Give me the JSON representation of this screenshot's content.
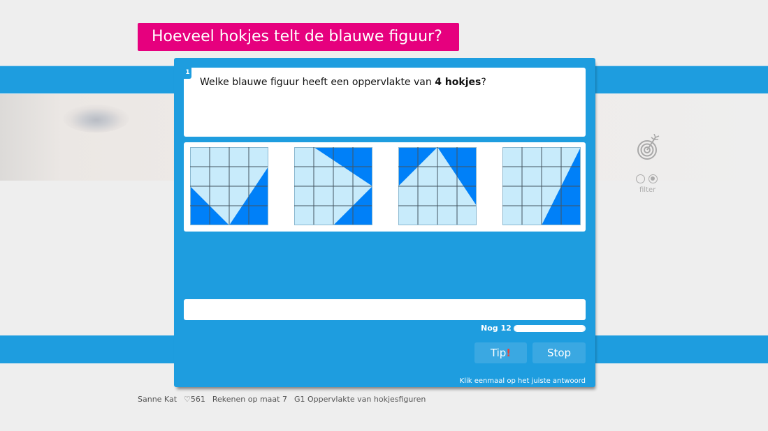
{
  "header": {
    "title": "Hoeveel hokjes telt de blauwe figuur?"
  },
  "question": {
    "number": "1",
    "text_before": "Welke blauwe figuur heeft een oppervlakte van ",
    "text_bold": "4 hokjes",
    "text_after": "?"
  },
  "options": [
    {
      "label": "figuur-1",
      "dark_polygons": [
        [
          [
            0,
            2
          ],
          [
            0,
            4
          ],
          [
            2,
            4
          ]
        ],
        [
          [
            4,
            1
          ],
          [
            4,
            4
          ],
          [
            2,
            4
          ]
        ]
      ]
    },
    {
      "label": "figuur-2",
      "dark_polygons": [
        [
          [
            1,
            0
          ],
          [
            4,
            0
          ],
          [
            4,
            2
          ]
        ],
        [
          [
            4,
            2
          ],
          [
            4,
            4
          ],
          [
            2,
            4
          ]
        ]
      ]
    },
    {
      "label": "figuur-3",
      "dark_polygons": [
        [
          [
            0,
            0
          ],
          [
            2,
            0
          ],
          [
            0,
            2
          ]
        ],
        [
          [
            2,
            0
          ],
          [
            4,
            0
          ],
          [
            4,
            3
          ]
        ]
      ]
    },
    {
      "label": "figuur-4",
      "dark_polygons": [
        [
          [
            4,
            0
          ],
          [
            4,
            4
          ],
          [
            2,
            4
          ]
        ]
      ]
    }
  ],
  "grid": {
    "cells": 4,
    "light_color": "#c8ebfb",
    "dark_color": "#0080f8",
    "line_color": "#445560"
  },
  "answer": {
    "value": ""
  },
  "progress": {
    "label": "Nog 12",
    "remaining": 12,
    "fraction": 1.0
  },
  "buttons": {
    "tip": "Tip",
    "tip_mark": "!",
    "stop": "Stop"
  },
  "instruction": "Klik eenmaal op het juiste antwoord",
  "side": {
    "icon": "target-icon",
    "filter_label": "filter",
    "filter_selected": 1
  },
  "footer": {
    "user": "Sanne Kat",
    "hearts": "♡561",
    "course": "Rekenen op maat 7",
    "lesson": "G1 Oppervlakte van hokjesfiguren"
  },
  "colors": {
    "brand_blue": "#1e9ddf",
    "title_magenta": "#e6007e",
    "tip_red": "#e8453c"
  }
}
